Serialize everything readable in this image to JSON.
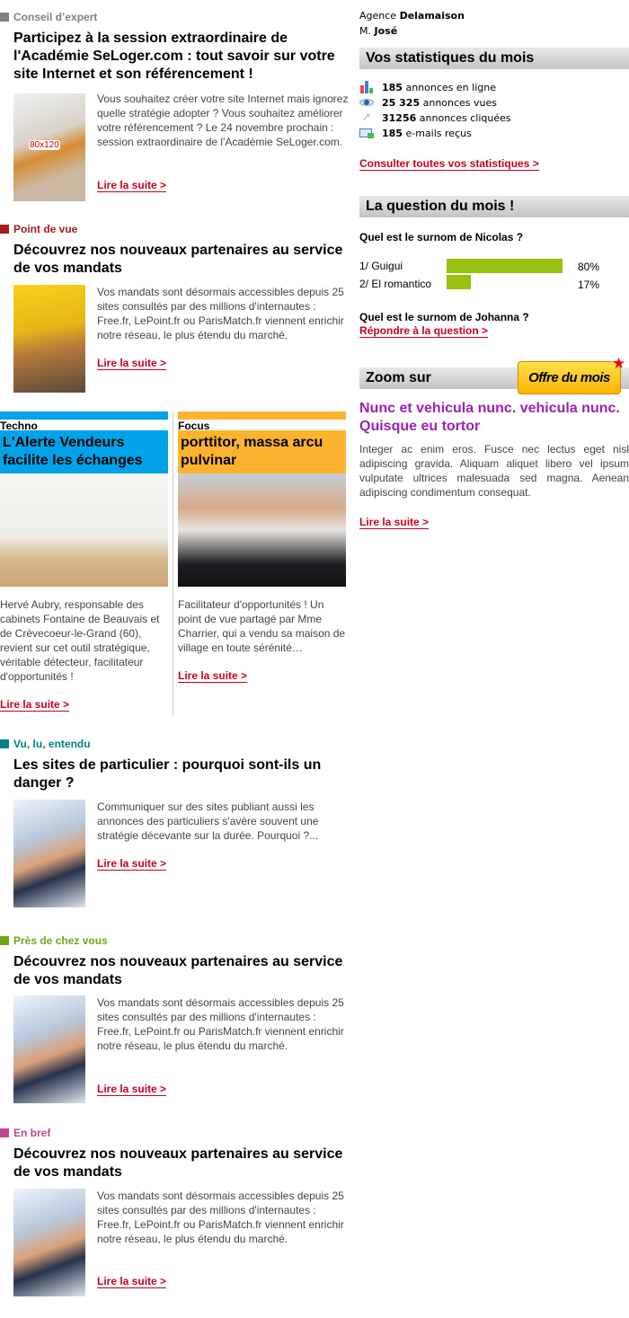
{
  "articles": [
    {
      "category": "Conseil d’expert",
      "title": "Participez à la session extraordinaire de l'Académie SeLoger.com : tout savoir sur votre site Internet et son référencement !",
      "image_label": "80x120",
      "text": "Vous souhaitez créer votre site Internet mais ignorez quelle stratégie adopter ? Vous souhaitez améliorer votre référencement ? Le 24 novembre prochain : session extraordinaire de l'Académie SeLoger.com.",
      "link": "Lire la suite >"
    },
    {
      "category": "Point de vue",
      "title": "Découvrez nos nouveaux partenaires au service de vos mandats",
      "text": "Vos mandats sont désormais accessibles depuis 25 sites consultés par des millions d'internautes : Free.fr, LePoint.fr ou ParisMatch.fr viennent enrichir notre réseau, le plus étendu du marché.",
      "link": "Lire la suite >"
    },
    {
      "category": "Vu, lu, entendu",
      "title": "Les sites de particulier : pourquoi sont-ils un danger ?",
      "text": "Communiquer sur des sites publiant aussi les annonces des particuliers s'avère souvent une stratégie décevante sur la durée. Pourquoi ?...",
      "link": "Lire la suite >"
    },
    {
      "category": "Près de chez vous",
      "title": "Découvrez nos nouveaux partenaires au service de vos mandats",
      "text": "Vos mandats sont désormais accessibles depuis 25 sites consultés par des millions d'internautes : Free.fr, LePoint.fr ou ParisMatch.fr viennent enrichir notre réseau, le plus étendu du marché.",
      "link": "Lire la suite >"
    },
    {
      "category": "En bref",
      "title": "Découvrez nos nouveaux partenaires au service de vos mandats",
      "text": "Vos mandats sont désormais accessibles depuis 25 sites consultés par des millions d'internautes : Free.fr, LePoint.fr ou ParisMatch.fr viennent enrichir notre réseau, le plus étendu du marché.",
      "link": "Lire la suite >"
    }
  ],
  "columns": [
    {
      "category": "Techno",
      "title": "L'Alerte Vendeurs facilite les échanges",
      "text": "Hervé Aubry, responsable des cabinets Fontaine de Beauvais et de Crèvecoeur-le-Grand (60), revient sur cet outil stratégique, véritable détecteur, facilitateur d'opportunités !",
      "link": "Lire la suite >",
      "color": "#00a3e8"
    },
    {
      "category": "Focus",
      "title": "porttitor, massa arcu pulvinar",
      "text": "Facilitateur d'opportunités ! Un point de vue partagé par Mme Charrier, qui a vendu sa maison de village en toute sérénité…",
      "link": "Lire la suite >",
      "color": "#fdb330"
    }
  ],
  "colors": {
    "conseil": "#808080",
    "point": "#a61c1c",
    "vu": "#008080",
    "pres": "#6fa616",
    "bref": "#c0468f",
    "link": "#c8001e",
    "poll_bar": "#97c10f",
    "zoom_title": "#9b22b5"
  },
  "agency": {
    "label": "Agence",
    "name": "Delamaison",
    "person_prefix": "M.",
    "person": "José"
  },
  "stats": {
    "title": "Vos statistiques du mois",
    "items": [
      {
        "icon": "bar-chart-icon",
        "value": "185",
        "label": "annonces en ligne"
      },
      {
        "icon": "eye-icon",
        "value": "25 325",
        "label": "annonces vues"
      },
      {
        "icon": "cursor-icon",
        "value": "31256",
        "label": "annonces cliquées"
      },
      {
        "icon": "mail-icon",
        "value": "185",
        "label": "e-mails reçus"
      }
    ],
    "link": "Consulter toutes vos statistiques >"
  },
  "question": {
    "title": "La question du mois !",
    "q1": "Quel est le surnom de Nicolas ?",
    "answers": [
      {
        "label": "1/ Guigui",
        "percent": 80,
        "percent_text": "80%"
      },
      {
        "label": "2/ El romantico",
        "percent": 17,
        "percent_text": "17%"
      }
    ],
    "q2": "Quel est le surnom de Johanna ?",
    "link": "Répondre à la question >"
  },
  "zoom": {
    "title": "Zoom sur",
    "badge": "Offre du mois",
    "headline": "Nunc et vehicula nunc. vehicula nunc. Quisque eu tortor",
    "text": "Integer ac enim eros. Fusce nec lectus eget nisl adipiscing gravida. Aliquam aliquet libero vel ipsum vulputate ultrices malesuada sed magna. Aenean adipiscing condimentum consequat.",
    "link": "Lire la suite >"
  }
}
